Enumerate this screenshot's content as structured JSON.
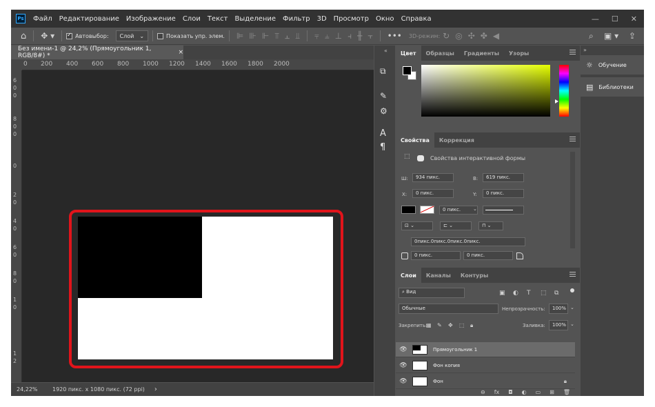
{
  "menu": {
    "logo": "Ps",
    "items": [
      "Файл",
      "Редактирование",
      "Изображение",
      "Слои",
      "Текст",
      "Выделение",
      "Фильтр",
      "3D",
      "Просмотр",
      "Окно",
      "Справка"
    ]
  },
  "window_controls": {
    "minimize": "—",
    "maximize": "☐",
    "close": "✕"
  },
  "options": {
    "autoselect_label": "Автовыбор:",
    "autoselect_value": "Слой",
    "show_controls_label": "Показать упр. элем.",
    "mode_3d_label": "3D-режим:"
  },
  "document": {
    "tab_title": "Без имени-1 @ 24,2% (Прямоугольник 1, RGB/8#) *",
    "close_glyph": "×",
    "ruler_h_labels": [
      "0",
      "200",
      "400",
      "600",
      "800",
      "1000",
      "1200",
      "1400",
      "1600",
      "1800",
      "2000"
    ],
    "ruler_v_labels": [
      "6",
      "0",
      "0",
      "8",
      "0",
      "0",
      "0",
      "2",
      "0",
      "4",
      "0",
      "6",
      "0",
      "8",
      "0",
      "1",
      "0",
      "1",
      "2"
    ]
  },
  "status": {
    "zoom": "24,22%",
    "doc_info": "1920 пикс. x 1080 пикс. (72 ppi)",
    "arrow": "›"
  },
  "color_panel": {
    "tabs": [
      "Цвет",
      "Образцы",
      "Градиенты",
      "Узоры"
    ],
    "active_tab": "Цвет"
  },
  "properties_panel": {
    "tabs": [
      "Свойства",
      "Коррекция"
    ],
    "active_tab": "Свойства",
    "type_label": "Свойства интерактивной формы",
    "w_label": "Ш:",
    "w_value": "934 пикс.",
    "h_label": "В:",
    "h_value": "619 пикс.",
    "x_label": "X:",
    "x_value": "0 пикс.",
    "y_label": "Y:",
    "y_value": "0 пикс.",
    "stroke_width": "0 пикс.",
    "corners_value": "0пикс.0пикс.0пикс.0пикс.",
    "corner_a": "0 пикс.",
    "corner_b": "0 пикс."
  },
  "layers_panel": {
    "tabs": [
      "Слои",
      "Каналы",
      "Контуры"
    ],
    "active_tab": "Слои",
    "filter_value": "Вид",
    "blend_mode": "Обычные",
    "opacity_label": "Непрозрачность:",
    "opacity_value": "100%",
    "lock_label": "Закрепить:",
    "fill_label": "Заливка:",
    "fill_value": "100%",
    "layers": [
      {
        "name": "Прямоугольник 1",
        "selected": true,
        "locked": false
      },
      {
        "name": "Фон копия",
        "selected": false,
        "locked": false
      },
      {
        "name": "Фон",
        "selected": false,
        "locked": true
      }
    ]
  },
  "right_column": {
    "items": [
      {
        "label": "Обучение",
        "icon": "lightbulb-icon"
      },
      {
        "label": "Библиотеки",
        "icon": "library-icon"
      }
    ]
  }
}
